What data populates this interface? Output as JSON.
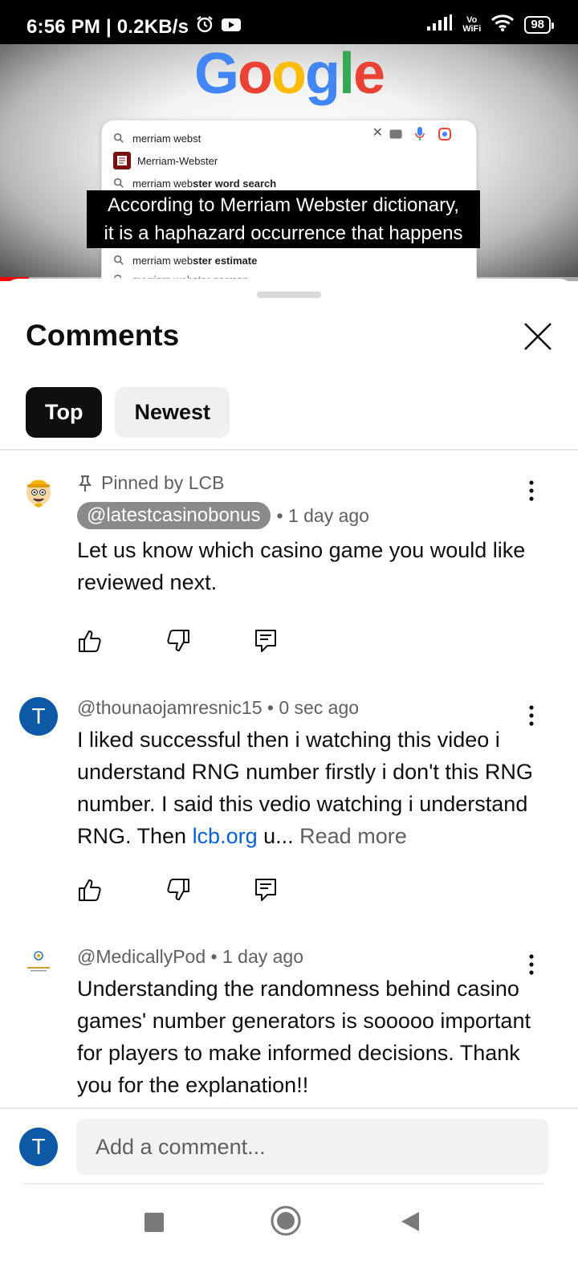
{
  "status_bar": {
    "time_speed": "6:56 PM | 0.2KB/s",
    "vowifi_top": "Vo",
    "vowifi_bottom": "WiFi",
    "battery": "98",
    "icons": [
      "alarm-icon",
      "youtube-icon",
      "signal-icon",
      "wifi-icon",
      "battery-icon"
    ]
  },
  "video": {
    "google_letters": [
      "G",
      "o",
      "o",
      "g",
      "l",
      "e"
    ],
    "google_colors": [
      "#4285F4",
      "#EA4335",
      "#FBBC05",
      "#4285F4",
      "#34A853",
      "#EA4335"
    ],
    "search_query": "merriam webst",
    "suggestions": [
      {
        "text": "Merriam-Webster",
        "bold": "",
        "icon": "merriam-webster-logo"
      },
      {
        "text": "merriam web",
        "bold": "ster word search",
        "icon": "search-icon"
      },
      {
        "text": "merriam web",
        "bold": "ster estimate",
        "icon": "search-icon"
      },
      {
        "text": "merriam webster german",
        "bold": "",
        "icon": "search-icon"
      }
    ],
    "caption_line1": "According to Merriam Webster dictionary,",
    "caption_line2": "it is a haphazard occurrence that happens",
    "progress": 0.05
  },
  "sheet": {
    "title": "Comments",
    "tabs": [
      {
        "label": "Top",
        "active": true
      },
      {
        "label": "Newest",
        "active": false
      }
    ]
  },
  "comments": [
    {
      "pinned_label": "Pinned by LCB",
      "author": "@latestcasinobonus",
      "age": "• 1 day ago",
      "text": "Let us know which casino game you would like reviewed next.",
      "avatar_letter": ""
    },
    {
      "author": "@thounaojamresnic15",
      "age": "• 0 sec ago",
      "text_before_link": "I liked successful then i watching this video i understand RNG number firstly i don't this RNG number. I said this vedio watching i understand RNG. Then ",
      "link": "lcb.org",
      "text_after_link": " u...",
      "read_more": "Read more",
      "avatar_letter": "T"
    },
    {
      "author": "@MedicallyPod",
      "age": "• 1 day ago",
      "text": "Understanding the randomness behind casino games' number generators is sooooo important for players to make informed decisions. Thank you for the explanation!!",
      "avatar_letter": ""
    }
  ],
  "composer": {
    "avatar_letter": "T",
    "placeholder": "Add a comment..."
  },
  "colors": {
    "accent_blue": "#065fd4",
    "avatar_blue": "#0e5aa7",
    "progress_red": "#ff0000"
  }
}
